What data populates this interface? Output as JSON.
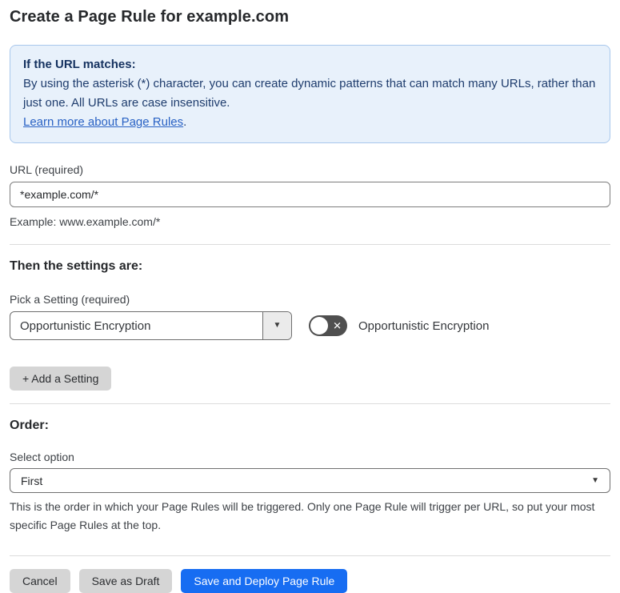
{
  "page": {
    "title": "Create a Page Rule for example.com"
  },
  "info_box": {
    "heading": "If the URL matches:",
    "body": "By using the asterisk (*) character, you can create dynamic patterns that can match many URLs, rather than just one. All URLs are case insensitive.",
    "link_label": "Learn more about Page Rules",
    "link_suffix": "."
  },
  "url_field": {
    "label": "URL (required)",
    "value": "*example.com/*",
    "helper": "Example: www.example.com/*"
  },
  "settings_section": {
    "heading": "Then the settings are:",
    "setting_label": "Pick a Setting (required)",
    "setting_value": "Opportunistic Encryption",
    "toggle_state": "off",
    "toggle_glyph": "✕",
    "toggle_label": "Opportunistic Encryption",
    "add_button_label": "+ Add a Setting",
    "dropdown_arrow": "▼"
  },
  "order_section": {
    "heading": "Order:",
    "select_label": "Select option",
    "select_value": "First",
    "select_arrow": "▼",
    "helper": "This is the order in which your Page Rules will be triggered. Only one Page Rule will trigger per URL, so put your most specific Page Rules at the top."
  },
  "footer": {
    "cancel_label": "Cancel",
    "save_draft_label": "Save as Draft",
    "save_deploy_label": "Save and Deploy Page Rule"
  },
  "colors": {
    "accent_blue": "#176df2",
    "info_background": "#e8f1fb",
    "info_border": "#a8c7ec",
    "info_text": "#1e3c6d",
    "link_blue": "#2861c4",
    "toggle_off_background": "#4f4f4f",
    "button_gray": "#d5d5d5",
    "divider_gray": "#dcdcdc"
  }
}
